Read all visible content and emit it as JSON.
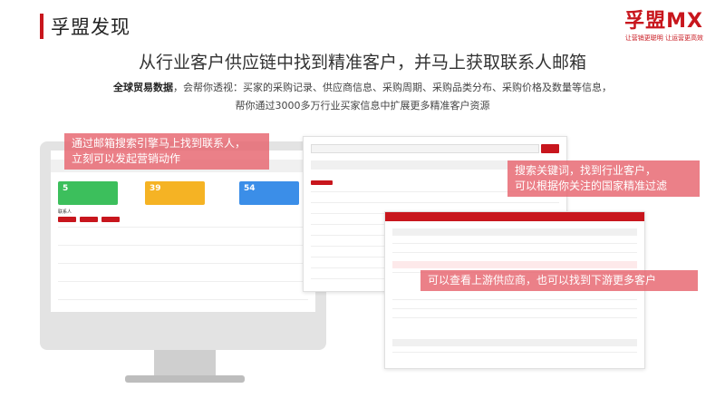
{
  "slide": {
    "title": "孚盟发现",
    "headline": "从行业客户供应链中找到精准客户，并马上获取联系人邮箱",
    "desc_bold": "全球贸易数据",
    "desc_rest": "，会帮你透视：买家的采购记录、供应商信息、采购周期、采购品类分布、采购价格及数量等信息，",
    "desc_line2": "帮你通过3000多万行业买家信息中扩展更多精准客户资源"
  },
  "logo": {
    "mark": "孚盟MX",
    "tagline": "让营销更聪明 让运营更高效"
  },
  "callouts": {
    "email_line1": "通过邮箱搜索引擎马上找到联系人，",
    "email_line2": "立刻可以发起营销动作",
    "keyword_line1": "搜索关键词，找到行业客户，",
    "keyword_line2": "可以根据你关注的国家精准过滤",
    "supply": "可以查看上游供应商，也可以找到下游更多客户"
  },
  "monitor_screen": {
    "stats": [
      {
        "value": "5",
        "color": "#3cbf5c"
      },
      {
        "value": "39",
        "color": "#f5b324"
      },
      {
        "value": "54",
        "color": "#3b8ee8"
      }
    ],
    "section_label": "联系人"
  },
  "colors": {
    "brand_red": "#c8161d",
    "callout": "#e6646e"
  },
  "icons": {
    "search": "search-icon",
    "monitor": "monitor-icon"
  }
}
